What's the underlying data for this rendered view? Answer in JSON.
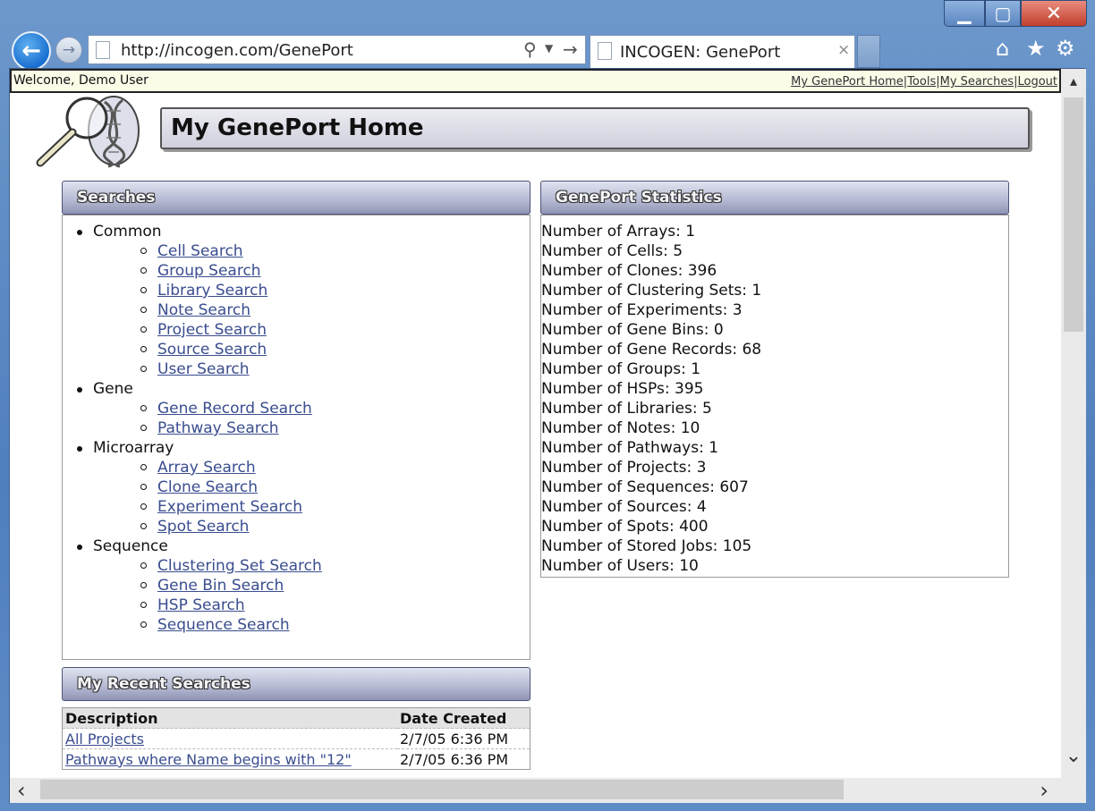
{
  "browser": {
    "url": "http://incogen.com/GenePort",
    "tab_title": "INCOGEN: GenePort",
    "tab_close": "×",
    "window_buttons": {
      "minimize": "▁",
      "maximize": "▢",
      "close": "✕"
    }
  },
  "header": {
    "welcome": "Welcome, Demo User",
    "links": [
      "My GenePort Home",
      "Tools",
      "My Searches",
      "Logout"
    ],
    "separator": "|",
    "page_title": "My GenePort Home"
  },
  "searches": {
    "title": "Searches",
    "categories": [
      {
        "label": "Common",
        "items": [
          "Cell Search",
          "Group Search",
          "Library Search",
          "Note Search",
          "Project Search",
          "Source Search",
          "User Search"
        ]
      },
      {
        "label": "Gene",
        "items": [
          "Gene Record Search",
          "Pathway Search"
        ]
      },
      {
        "label": "Microarray",
        "items": [
          "Array Search",
          "Clone Search",
          "Experiment Search",
          "Spot Search"
        ]
      },
      {
        "label": "Sequence",
        "items": [
          "Clustering Set Search",
          "Gene Bin Search",
          "HSP Search",
          "Sequence Search"
        ]
      }
    ]
  },
  "statistics": {
    "title": "GenePort Statistics",
    "rows": [
      "Number of Arrays: 1",
      "Number of Cells: 5",
      "Number of Clones: 396",
      "Number of Clustering Sets: 1",
      "Number of Experiments: 3",
      "Number of Gene Bins: 0",
      "Number of Gene Records: 68",
      "Number of Groups: 1",
      "Number of HSPs: 395",
      "Number of Libraries: 5",
      "Number of Notes: 10",
      "Number of Pathways: 1",
      "Number of Projects: 3",
      "Number of Sequences: 607",
      "Number of Sources: 4",
      "Number of Spots: 400",
      "Number of Stored Jobs: 105",
      "Number of Users: 10"
    ]
  },
  "recent": {
    "title": "My Recent Searches",
    "columns": [
      "Description",
      "Date Created"
    ],
    "rows": [
      {
        "description": "All Projects",
        "date": "2/7/05 6:36 PM"
      },
      {
        "description": "Pathways where Name begins with \"12\"",
        "date": "2/7/05 6:36 PM"
      }
    ]
  }
}
